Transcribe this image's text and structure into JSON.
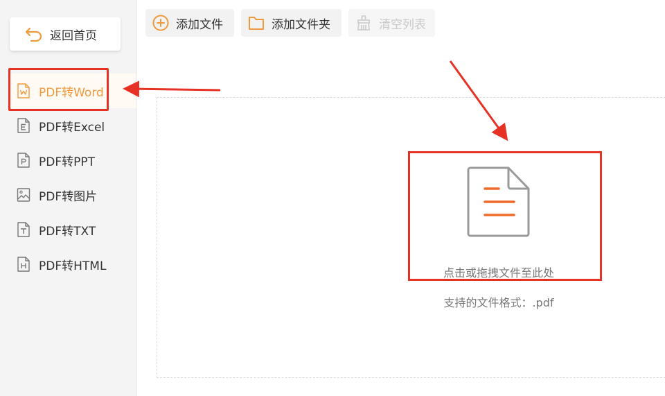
{
  "sidebar": {
    "back_label": "返回首页",
    "items": [
      {
        "label": "PDF转Word",
        "icon": "word-file-icon",
        "active": true
      },
      {
        "label": "PDF转Excel",
        "icon": "excel-file-icon",
        "active": false
      },
      {
        "label": "PDF转PPT",
        "icon": "ppt-file-icon",
        "active": false
      },
      {
        "label": "PDF转图片",
        "icon": "image-file-icon",
        "active": false
      },
      {
        "label": "PDF转TXT",
        "icon": "txt-file-icon",
        "active": false
      },
      {
        "label": "PDF转HTML",
        "icon": "html-file-icon",
        "active": false
      }
    ]
  },
  "toolbar": {
    "add_file_label": "添加文件",
    "add_folder_label": "添加文件夹",
    "clear_list_label": "清空列表"
  },
  "drop_zone": {
    "prompt": "点击或拖拽文件至此处",
    "formats": "支持的文件格式：.pdf"
  },
  "colors": {
    "accent": "#f09a3e",
    "highlight_red": "#e53224",
    "doc_lines": "#f06a2b"
  }
}
